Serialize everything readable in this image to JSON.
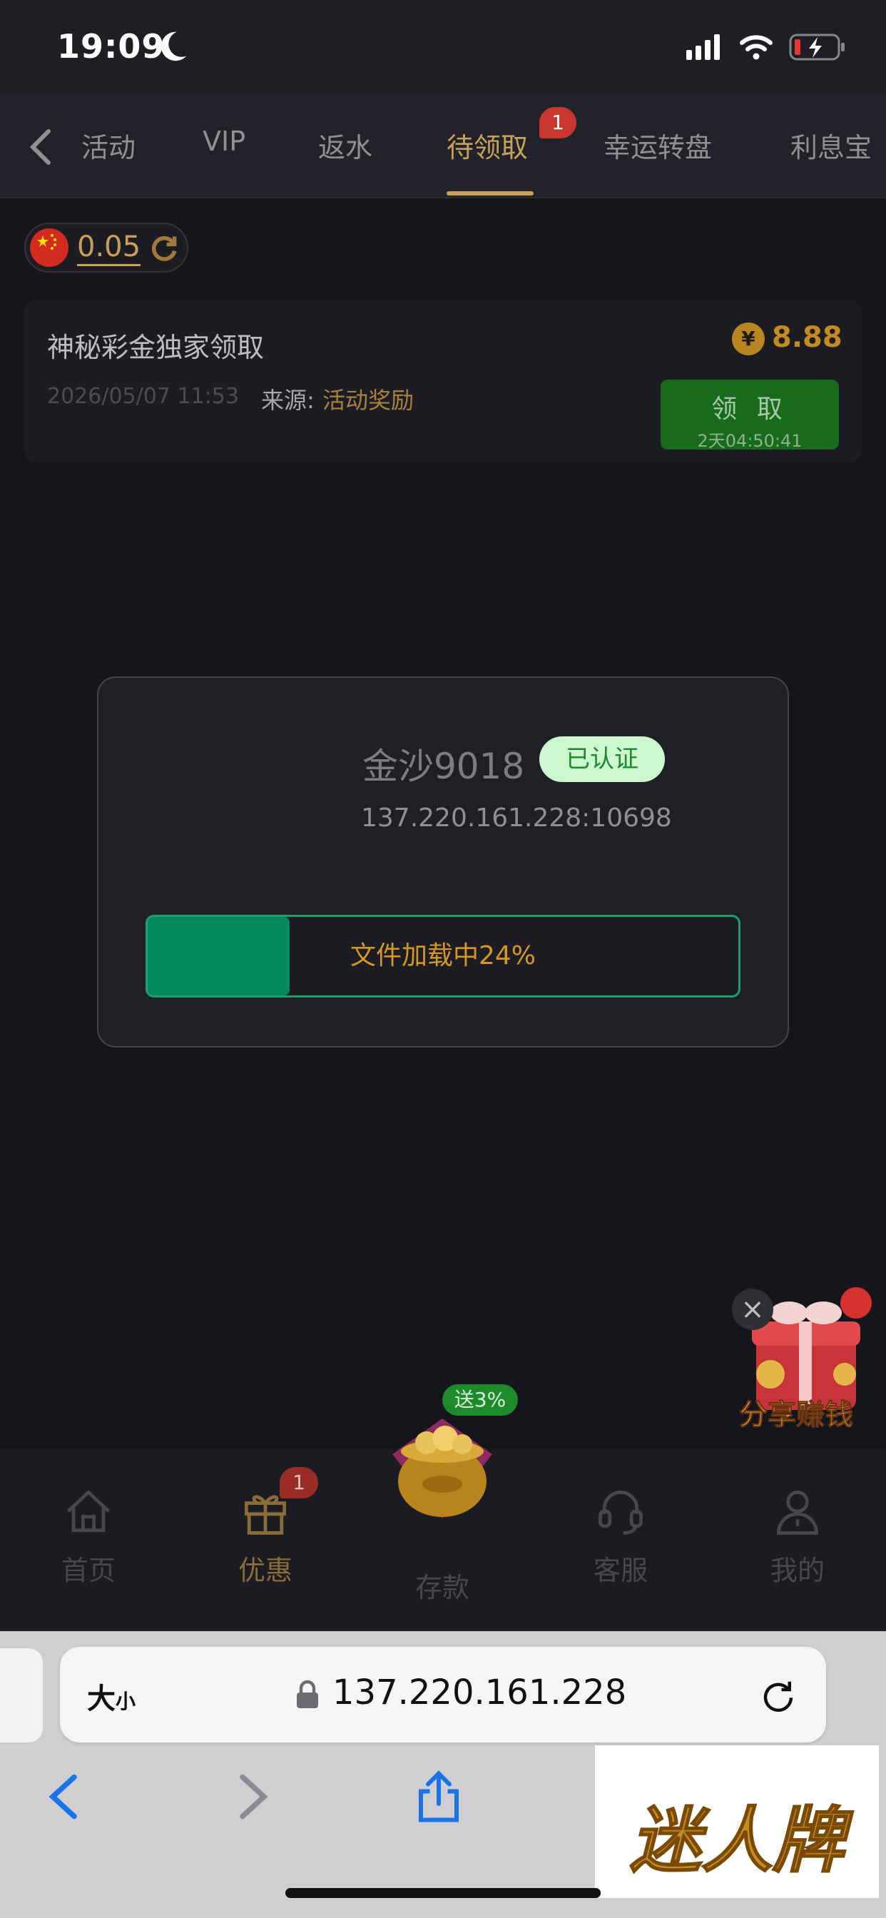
{
  "status_bar": {
    "time": "19:09"
  },
  "tabs": {
    "items": [
      {
        "label": "活动"
      },
      {
        "label": "VIP"
      },
      {
        "label": "返水"
      },
      {
        "label": "待领取",
        "active": true,
        "badge": "1"
      },
      {
        "label": "幸运转盘"
      },
      {
        "label": "利息宝"
      }
    ]
  },
  "balance": {
    "value": "0.05"
  },
  "reward_card": {
    "title": "神秘彩金独家领取",
    "time": "2026/05/07 11:53",
    "source_label": "来源:",
    "source": "活动奖励",
    "currency_symbol": "¥",
    "amount": "8.88",
    "claim_label": "领 取",
    "claim_timer": "2天04:50:41"
  },
  "loading_modal": {
    "site_name": "金沙9018",
    "verified_label": "已认证",
    "address": "137.220.161.228:10698",
    "progress_percent": 24,
    "progress_text": "文件加载中24%"
  },
  "share_float": {
    "label": "分享赚钱"
  },
  "bottom_nav": {
    "items": [
      {
        "label": "首页",
        "icon": "home-icon"
      },
      {
        "label": "优惠",
        "icon": "gift-icon",
        "active": true,
        "badge": "1"
      },
      {
        "label": "存款",
        "icon": "deposit-pot-icon",
        "badge": "送3%"
      },
      {
        "label": "客服",
        "icon": "headset-icon"
      },
      {
        "label": "我的",
        "icon": "user-icon"
      }
    ]
  },
  "browser": {
    "text_size_label": "大",
    "text_size_small": "小",
    "url": "137.220.161.228"
  },
  "watermark": {
    "text": "迷人牌"
  },
  "colors": {
    "accent_gold": "#c9a05b",
    "claim_green": "#176b1a",
    "progress_green": "#048a5e",
    "badge_red": "#c8372f"
  }
}
